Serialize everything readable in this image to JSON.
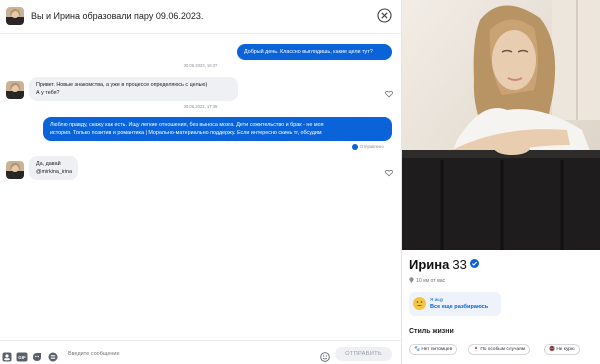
{
  "header": {
    "title": "Вы и Ирина образовали пару 09.06.2023."
  },
  "messages": [
    {
      "side": "out",
      "text": "Добрый день. Классно выглядишь, какие цели тут?"
    },
    {
      "side": "stamp",
      "text": "30.06.2023, 16:37"
    },
    {
      "side": "in",
      "lines": [
        "Привет. Новые знакомства, а уже в процессе определяюсь с целью)",
        "А у тебя?"
      ]
    },
    {
      "side": "stamp",
      "text": "30.06.2023, 17:39"
    },
    {
      "side": "out",
      "lines": [
        "Люблю правду, скажу как есть. Ищу легкие отношения, без выноса мозга. Дети сожительство и брак - не моя",
        "история. Только позитив и романтика | Морально-материально поддержу. Если интересно скинь тг, обсудим"
      ]
    },
    {
      "side": "status",
      "text": "Отправлено"
    },
    {
      "side": "in",
      "lines": [
        "Да, давай",
        "@mirkina_irina"
      ]
    }
  ],
  "composer": {
    "placeholder": "Введите сообщение",
    "send_label": "ОТПРАВИТЬ",
    "gif_label": "GIF"
  },
  "profile": {
    "name": "Ирина",
    "age": "33",
    "distance": "10 км от вас",
    "seeking_label": "Я ищу",
    "seeking_value": "Все еще разбираюсь",
    "lifestyle_title": "Стиль жизни",
    "lifestyle_chips": [
      "Нет питомцев",
      "По особым случаям",
      "Не курю"
    ]
  },
  "colors": {
    "accent": "#0a63d8",
    "bubble_in": "#eef0f3"
  }
}
